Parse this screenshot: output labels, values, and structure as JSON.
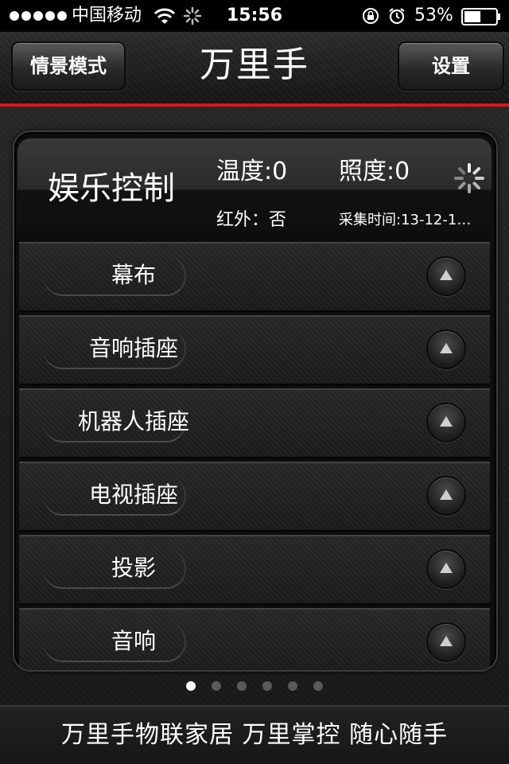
{
  "status_bar": {
    "carrier": "中国移动",
    "time": "15:56",
    "battery_percent": "53%",
    "battery_level": 0.53
  },
  "header": {
    "left_button": "情景模式",
    "title": "万里手",
    "right_button": "设置"
  },
  "panel": {
    "section_title": "娱乐控制",
    "temperature": "温度:0",
    "illuminance": "照度:0",
    "infrared": "红外：否",
    "collect_time": "采集时间:13-12-1…"
  },
  "devices": [
    {
      "label": "幕布"
    },
    {
      "label": "音响插座"
    },
    {
      "label": "机器人插座"
    },
    {
      "label": "电视插座"
    },
    {
      "label": "投影"
    },
    {
      "label": "音响"
    }
  ],
  "pagination": {
    "total": 6,
    "current": 1
  },
  "footer": {
    "slogan": "万里手物联家居 万里掌控  随心随手"
  },
  "colors": {
    "accent_red": "#c42020",
    "background": "#1b1b1b",
    "text": "#ffffff"
  }
}
